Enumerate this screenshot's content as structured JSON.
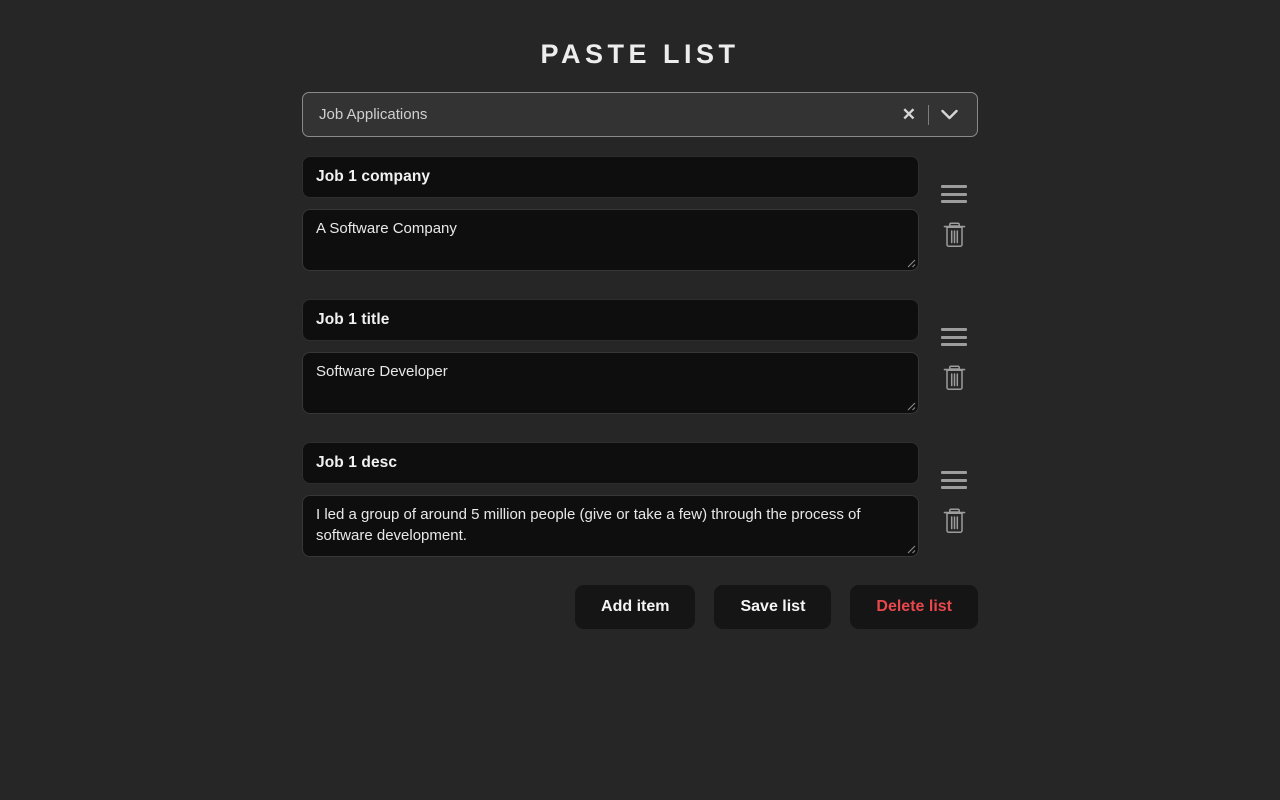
{
  "app": {
    "title": "PASTE LIST"
  },
  "list_selector": {
    "selected_value": "Job Applications",
    "clear_icon": "close-x-icon",
    "caret_icon": "chevron-down-icon"
  },
  "items": [
    {
      "label": "Job 1 company",
      "value": "A Software Company",
      "drag_icon": "drag-handle-icon",
      "delete_icon": "trash-icon"
    },
    {
      "label": "Job 1 title",
      "value": "Software Developer",
      "drag_icon": "drag-handle-icon",
      "delete_icon": "trash-icon"
    },
    {
      "label": "Job 1 desc",
      "value": "I led a group of around 5 million people (give or take a few) through the process of software development.",
      "drag_icon": "drag-handle-icon",
      "delete_icon": "trash-icon"
    }
  ],
  "actions": {
    "add_item_label": "Add item",
    "save_list_label": "Save list",
    "delete_list_label": "Delete list"
  },
  "colors": {
    "page_background": "#262626",
    "field_background": "#0e0e0e",
    "select_background": "#333333",
    "text_primary": "#f2f2f2",
    "text_secondary": "#cfcfcf",
    "danger": "#e8474c",
    "icon": "#9c9c9c"
  }
}
